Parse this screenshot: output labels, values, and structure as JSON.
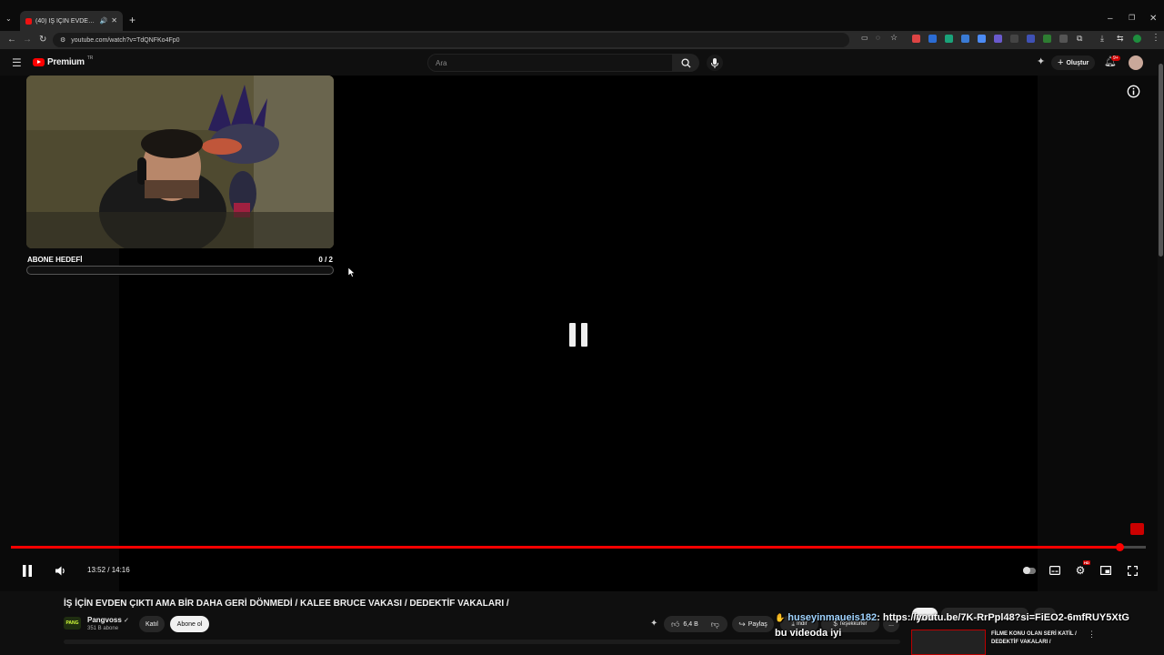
{
  "browser": {
    "tab_title": "(40) İŞ İÇİN EVDEN ÇIKTI A",
    "url": "youtube.com/watch?v=TdQNFKo4Fp0"
  },
  "header": {
    "logo_text": "Premium",
    "logo_sup": "TR",
    "search_placeholder": "Ara",
    "create_label": "Oluştur",
    "notif_badge": "9+"
  },
  "overlay_widget": {
    "goal_label": "ABONE HEDEFİ",
    "goal_count": "0 / 2",
    "goal_progress": 0
  },
  "player": {
    "time": "13:52 / 14:16",
    "progress": 0.977,
    "hd_badge": "HD"
  },
  "video": {
    "title": "İŞ İÇİN EVDEN ÇIKTI AMA BİR DAHA GERİ DÖNMEDİ / KALEE BRUCE VAKASI / DEDEKTİF VAKALARI /",
    "channel_name": "Pangvoss",
    "channel_avatar_text": "PANG",
    "subscribers": "351 B abone",
    "join_label": "Katıl",
    "subscribe_label": "Abone ol",
    "likes": "6,4 B",
    "share_label": "Paylaş",
    "download_label": "İndir",
    "thanks_label": "Teşekkürler",
    "more_label": "..."
  },
  "chat_overlay": {
    "username": "huseyinmaueis182",
    "message_part1": ": https://youtu.be/7K-RrPpl48?si=FiEO2-6mfRUY5XtG",
    "message_part2": "bu videoda iyi"
  },
  "recommendation": {
    "title": "FİLME KONU OLAN SERİ KATİL / DEDEKTİF VAKALARI /"
  },
  "colors": {
    "accent": "#ff0000",
    "background": "#0f0f0f"
  }
}
